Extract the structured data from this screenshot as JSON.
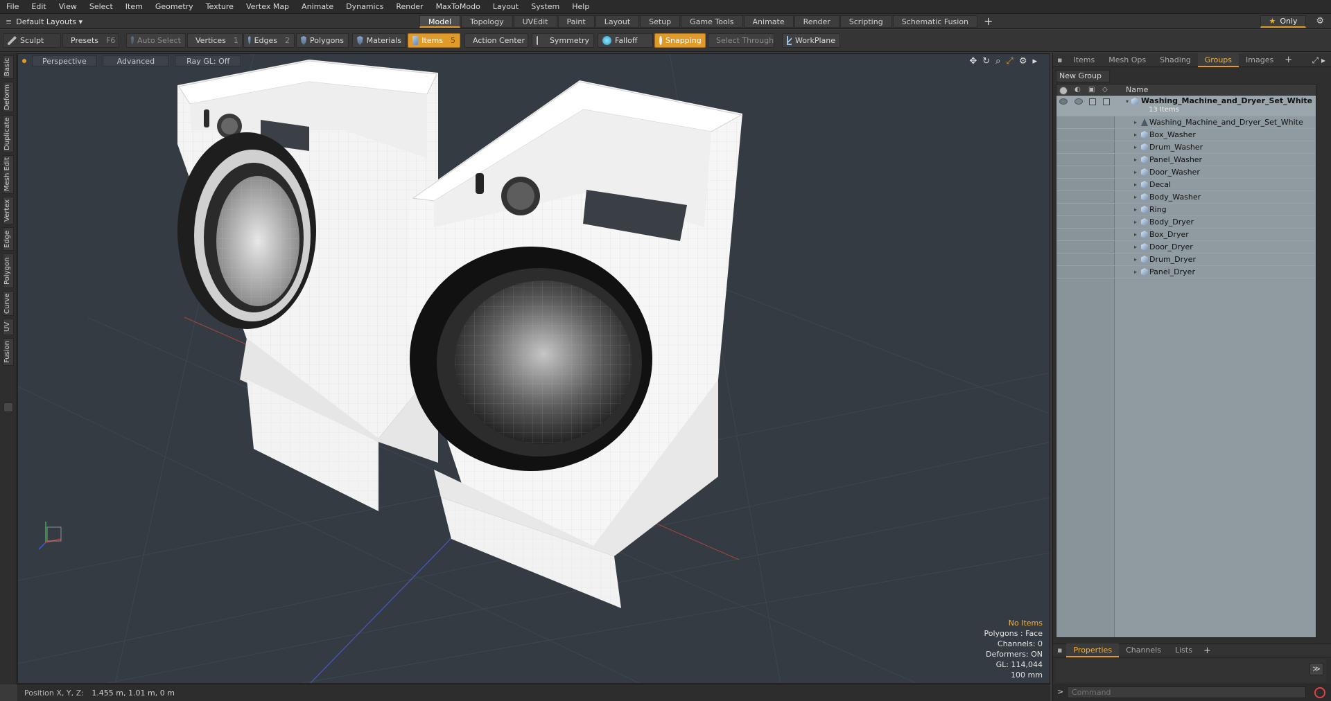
{
  "menu": [
    "File",
    "Edit",
    "View",
    "Select",
    "Item",
    "Geometry",
    "Texture",
    "Vertex Map",
    "Animate",
    "Dynamics",
    "Render",
    "MaxToModo",
    "Layout",
    "System",
    "Help"
  ],
  "layout_select": "Default Layouts ▾",
  "layout_tabs": [
    "Model",
    "Topology",
    "UVEdit",
    "Paint",
    "Layout",
    "Setup",
    "Game Tools",
    "Animate",
    "Render",
    "Scripting",
    "Schematic Fusion"
  ],
  "active_layout_tab": "Model",
  "only_label": "Only",
  "toolbar": {
    "sculpt": "Sculpt",
    "presets": "Presets",
    "presets_key": "F6",
    "auto_select": "Auto Select",
    "vertices": "Vertices",
    "vertices_count": "1",
    "edges": "Edges",
    "edges_count": "2",
    "polygons": "Polygons",
    "materials": "Materials",
    "items": "Items",
    "items_count": "5",
    "action_center": "Action Center",
    "symmetry": "Symmetry",
    "falloff": "Falloff",
    "snapping": "Snapping",
    "select_through": "Select Through",
    "workplane": "WorkPlane"
  },
  "left_tabs": [
    "Basic",
    "Deform",
    "Duplicate",
    "Mesh Edit",
    "Vertex",
    "Edge",
    "Polygon",
    "Curve",
    "UV",
    "Fusion"
  ],
  "viewport": {
    "view": "Perspective",
    "shading": "Advanced",
    "raygl": "Ray GL: Off",
    "stats": {
      "selection": "No Items",
      "polygons": "Polygons : Face",
      "channels": "Channels: 0",
      "deformers": "Deformers: ON",
      "gl": "GL: 114,044",
      "grid": "100 mm"
    }
  },
  "status": {
    "label": "Position X, Y, Z:",
    "value": "1.455 m, 1.01 m, 0 m"
  },
  "right_tabs": [
    "Items",
    "Mesh Ops",
    "Shading",
    "Groups",
    "Images"
  ],
  "active_right_tab": "Groups",
  "new_group": "New Group",
  "tree": {
    "name_header": "Name",
    "root": "Washing_Machine_and_Dryer_Set_White",
    "root_count": "13 Items",
    "children": [
      "Washing_Machine_and_Dryer_Set_White",
      "Box_Washer",
      "Drum_Washer",
      "Panel_Washer",
      "Door_Washer",
      "Decal",
      "Body_Washer",
      "Ring",
      "Body_Dryer",
      "Box_Dryer",
      "Door_Dryer",
      "Drum_Dryer",
      "Panel_Dryer"
    ]
  },
  "bottom_tabs": [
    "Properties",
    "Channels",
    "Lists"
  ],
  "active_bottom_tab": "Properties",
  "command_placeholder": "Command",
  "colors": {
    "accent": "#e39a29",
    "viewport_bg": "#343b42",
    "tree_bg": "#8f9aa1"
  }
}
